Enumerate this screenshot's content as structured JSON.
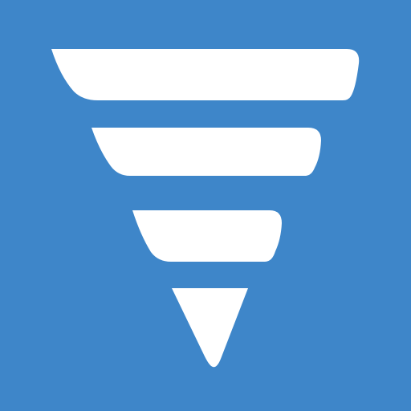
{
  "icon": {
    "name": "funnel-logo",
    "background_color": "#3E86C9",
    "foreground_color": "#FFFFFF"
  }
}
